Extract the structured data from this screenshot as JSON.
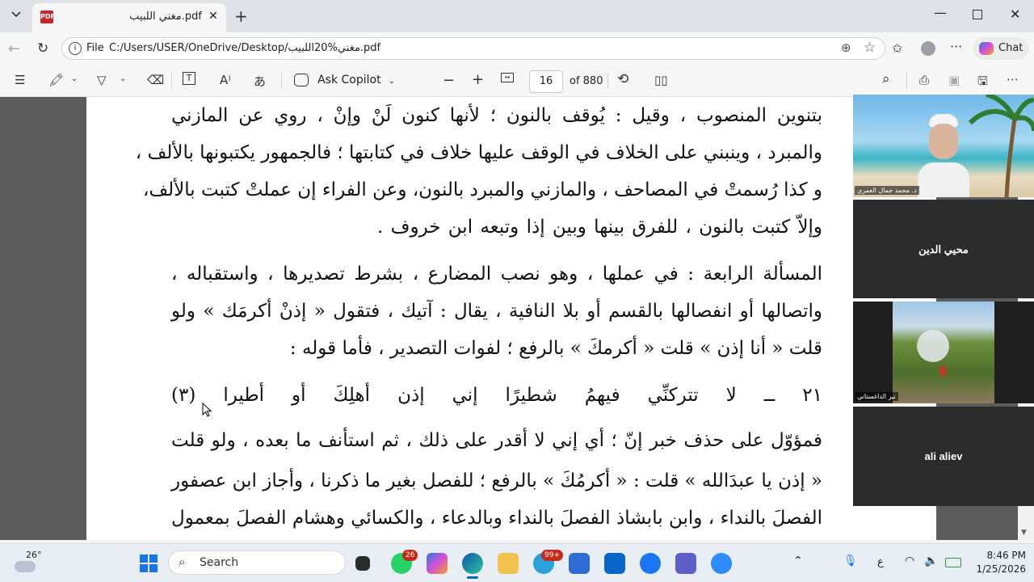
{
  "browser": {
    "tab_title": "مغني اللبيب.pdf",
    "tab_icon": "pdf-icon",
    "address_prefix": "File",
    "address_url": "C:/Users/USER/OneDrive/Desktop/مغني%20اللبيب.pdf",
    "chat_label": "Chat"
  },
  "pdf_toolbar": {
    "ask_copilot": "Ask Copilot",
    "page_number": "16",
    "page_total": "of 880"
  },
  "document": {
    "lines": [
      "بتنوين المنصوب ، وقيل : يُوقف بالنون ؛ لأنها كنون لَنْ وإنْ ، روي عن المازني",
      "والمبرد ، وينبني على الخلاف في الوقف عليها خلاف في كتابتها ؛ فالجمهور يكتبونها بالألف ،",
      "و كذا رُسمتْ في المصاحف ، والمازني والمبرد بالنون، وعن الفراء إن عملتْ كتبت بالألف،",
      "وإلاّ كتبت بالنون ، للفرق بينها وبين إذا وتبعه ابن خروف ."
    ],
    "heading": "المسألة الرابعة : في عملها ، وهو نصب المضارع ، بشرط تصديرها ، واستقباله ،",
    "lines2": [
      "واتصالها أو انفصالها بالقسم أو بلا النافية ، يقال : آتيك ، فتقول « إذنْ أكرمَك » ولو",
      "قلت « أنا إذن » قلت « أكرمكَ » بالرفع ؛ لفوات التصدير ، فأما قوله :"
    ],
    "verse": "٢١ ــ لا تتركنِّي فيهمُ شطيرًا     إني إذن أهلِكَ أو أطيرا (٣)",
    "lines3": [
      "فمؤوّل على حذف خبر إنّ ؛ أي إني لا أقدر على ذلك ، ثم استأنف ما بعده ، ولو قلت",
      "« إذن يا عبدَالله » قلت : « أكرمُكَ » بالرفع ؛ للفصل بغير ما ذكرنا ، وأجاز ابن عصفور",
      "الفصلَ بالنداء ، وابن بابشاذ الفصلَ بالنداء وبالدعاء ، والكسائي وهشام الفصلَ بمعمول"
    ]
  },
  "meeting": {
    "tiles": [
      {
        "label": "د. محمد جمال العمري",
        "type": "video-beach"
      },
      {
        "name": "محيي الدين"
      },
      {
        "label": "نير الداغستاني",
        "type": "video-outdoor"
      },
      {
        "name": "ali aliev"
      }
    ]
  },
  "taskbar": {
    "weather_temp": "26°",
    "search_placeholder": "Search",
    "whatsapp_badge": "26",
    "telegram_badge": "99+",
    "lang": "ع",
    "time": "8:46 PM",
    "date": "1/25/2026"
  },
  "colors": {
    "accent": "#0067c0",
    "pdf_red": "#c4262e"
  }
}
